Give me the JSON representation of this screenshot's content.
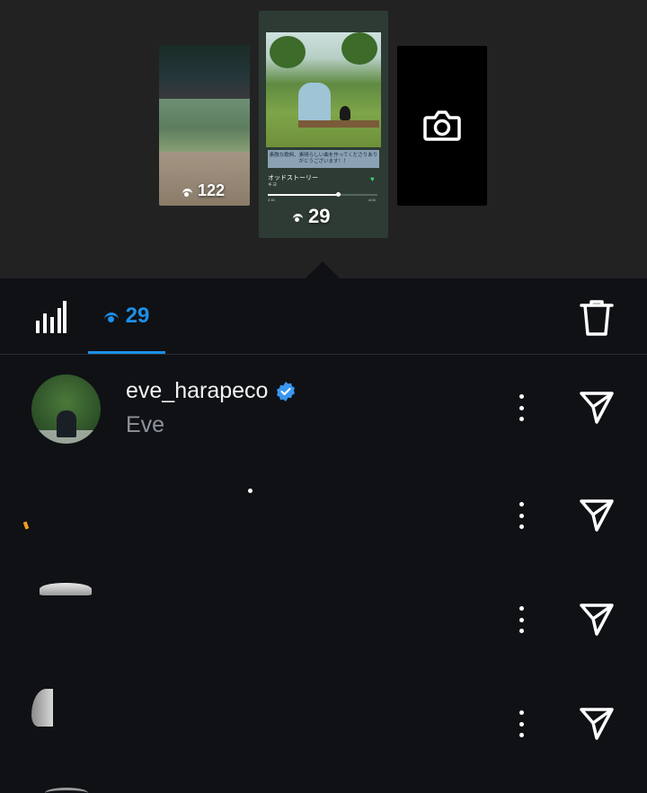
{
  "stories": {
    "left_views": "122",
    "center": {
      "caption": "素敵な歌詞、素晴らしい曲を作ってくださりありがとうございます！！",
      "song_title": "オッドストーリー",
      "artist": "キヨ",
      "time_elapsed": "2:40",
      "time_total": "4:04",
      "progress": 0.64,
      "views": "29"
    },
    "right_icon": "camera-icon"
  },
  "tabs": {
    "viewers_count": "29",
    "insights_icon": "bar-chart-icon",
    "delete_icon": "trash-icon"
  },
  "viewers": [
    {
      "username": "eve_harapeco",
      "fullname": "Eve",
      "verified": true
    },
    {
      "username": "",
      "fullname": "",
      "verified": false
    },
    {
      "username": "",
      "fullname": "",
      "verified": false
    },
    {
      "username": "",
      "fullname": "",
      "verified": false
    }
  ],
  "colors": {
    "accent": "#1d8fe8",
    "background": "#0f1115",
    "verified": "#3897f0",
    "heart": "#3ad26a"
  }
}
